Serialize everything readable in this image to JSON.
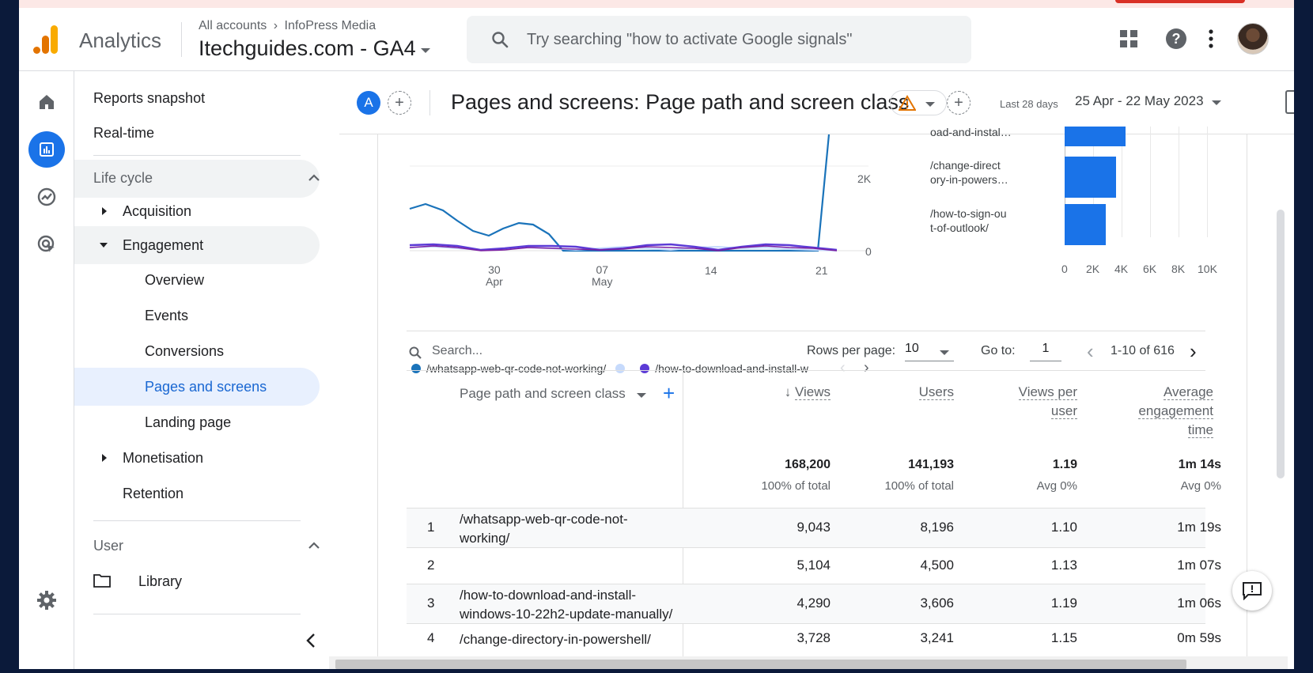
{
  "app": {
    "name": "Analytics"
  },
  "account": {
    "breadcrumb_root": "All accounts",
    "breadcrumb_account": "InfoPress Media",
    "property": "Itechguides.com - GA4"
  },
  "search": {
    "placeholder": "Try searching \"how to activate Google signals\""
  },
  "topbar_icons": [
    "apps-grid-icon",
    "help-icon",
    "more-vert-icon"
  ],
  "rail": [
    "home-icon",
    "reports-icon",
    "explore-icon",
    "advertising-icon",
    "settings-icon"
  ],
  "nav": {
    "reports_snapshot": "Reports snapshot",
    "realtime": "Real-time",
    "lifecycle": "Life cycle",
    "acquisition": "Acquisition",
    "engagement": "Engagement",
    "overview": "Overview",
    "events": "Events",
    "conversions": "Conversions",
    "pages_and_screens": "Pages and screens",
    "landing_page": "Landing page",
    "monetisation": "Monetisation",
    "retention": "Retention",
    "user": "User",
    "library": "Library"
  },
  "header": {
    "avatar_letter": "A",
    "title": "Pages and screens: Page path and screen class",
    "range_label": "Last 28 days",
    "date_range": "25 Apr - 22 May 2023"
  },
  "line_chart": {
    "y_ticks": [
      "2K",
      "0"
    ],
    "x_ticks": [
      {
        "day": "30",
        "month": "Apr"
      },
      {
        "day": "07",
        "month": "May"
      },
      {
        "day": "14",
        "month": ""
      },
      {
        "day": "21",
        "month": ""
      }
    ],
    "legend": [
      {
        "name": "/whatsapp-web-qr-code-not-working/",
        "color": "#1a73ba"
      },
      {
        "name": "",
        "color": "#c6dafc"
      },
      {
        "name": "/how-to-download-and-install-w",
        "color": "#5c3bd6"
      }
    ]
  },
  "bar_chart": {
    "partial_label": "oad-and-instal…",
    "bars": [
      {
        "label_line1": "/change-direct",
        "label_line2": "ory-in-powers…",
        "value": 3600
      },
      {
        "label_line1": "/how-to-sign-ou",
        "label_line2": "t-of-outlook/",
        "value": 2900
      }
    ],
    "partial_value": 4300,
    "x_ticks": [
      "0",
      "2K",
      "4K",
      "6K",
      "8K",
      "10K"
    ],
    "xmax": 10000
  },
  "table_controls": {
    "search_placeholder": "Search...",
    "rows_per_page_label": "Rows per page:",
    "rows_per_page": "10",
    "goto_label": "Go to:",
    "goto_value": "1",
    "pagination": "1-10 of 616"
  },
  "table": {
    "dimension_header": "Page path and screen class",
    "columns": [
      {
        "label_lines": [
          "Views"
        ],
        "total": "168,200",
        "sub": "100% of total",
        "sorted": true
      },
      {
        "label_lines": [
          "Users"
        ],
        "total": "141,193",
        "sub": "100% of total"
      },
      {
        "label_lines": [
          "Views per",
          "user"
        ],
        "total": "1.19",
        "sub": "Avg 0%"
      },
      {
        "label_lines": [
          "Average",
          "engagement",
          "time"
        ],
        "total": "1m 14s",
        "sub": "Avg 0%"
      }
    ],
    "rows": [
      {
        "n": "1",
        "path_lines": [
          "/whatsapp-web-qr-code-not-",
          "working/"
        ],
        "views": "9,043",
        "users": "8,196",
        "vpu": "1.10",
        "aet": "1m 19s"
      },
      {
        "n": "2",
        "path_lines": [
          ""
        ],
        "views": "5,104",
        "users": "4,500",
        "vpu": "1.13",
        "aet": "1m 07s"
      },
      {
        "n": "3",
        "path_lines": [
          "/how-to-download-and-install-",
          "windows-10-22h2-update-manually/"
        ],
        "views": "4,290",
        "users": "3,606",
        "vpu": "1.19",
        "aet": "1m 06s"
      },
      {
        "n": "4",
        "path_lines": [
          "/change-directory-in-powershell/"
        ],
        "views": "3,728",
        "users": "3,241",
        "vpu": "1.15",
        "aet": "0m 59s"
      }
    ]
  }
}
